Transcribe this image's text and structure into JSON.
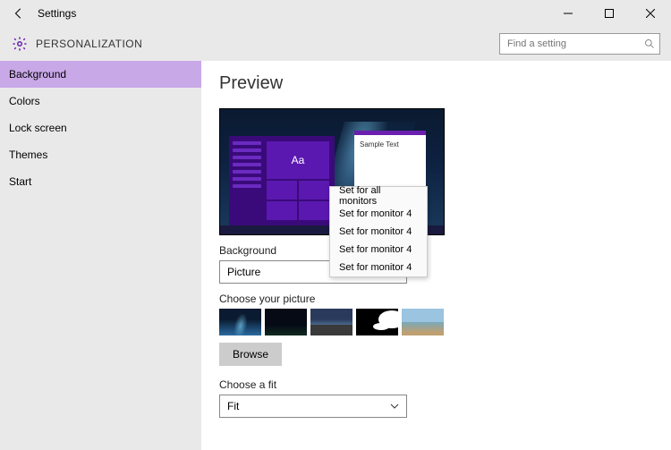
{
  "titlebar": {
    "title": "Settings"
  },
  "header": {
    "subtitle": "PERSONALIZATION",
    "search_placeholder": "Find a setting"
  },
  "sidebar": {
    "items": [
      {
        "label": "Background",
        "active": true
      },
      {
        "label": "Colors"
      },
      {
        "label": "Lock screen"
      },
      {
        "label": "Themes"
      },
      {
        "label": "Start"
      }
    ]
  },
  "main": {
    "heading": "Preview",
    "sample_text": "Sample Text",
    "aa": "Aa",
    "background_label": "Background",
    "background_value": "Picture",
    "choose_picture_label": "Choose your picture",
    "browse_label": "Browse",
    "fit_label": "Choose a fit",
    "fit_value": "Fit"
  },
  "context_menu": {
    "items": [
      {
        "label": "Set for all monitors"
      },
      {
        "label": "Set for monitor 4"
      },
      {
        "label": "Set for monitor 4"
      },
      {
        "label": "Set for monitor 4"
      },
      {
        "label": "Set for monitor 4"
      }
    ]
  }
}
